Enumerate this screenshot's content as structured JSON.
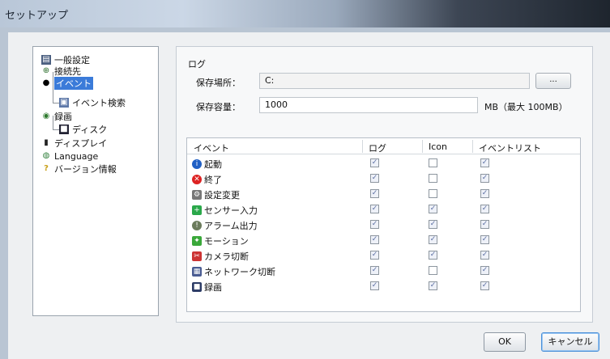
{
  "window": {
    "title": "セットアップ"
  },
  "tree": {
    "items": [
      {
        "label": "一般設定",
        "icon": "general-settings-icon"
      },
      {
        "label": "接続先",
        "icon": "connection-icon"
      },
      {
        "label": "イベント",
        "icon": "event-icon",
        "selected": true
      },
      {
        "label": "イベント検索",
        "icon": "event-search-icon"
      },
      {
        "label": "録画",
        "icon": "recording-icon"
      },
      {
        "label": "ディスク",
        "icon": "disk-icon"
      },
      {
        "label": "ディスプレイ",
        "icon": "display-icon"
      },
      {
        "label": "Language",
        "icon": "language-icon"
      },
      {
        "label": "バージョン情報",
        "icon": "version-info-icon"
      }
    ]
  },
  "log": {
    "group_title": "ログ",
    "save_location_label": "保存場所：",
    "save_location_value": "C:",
    "browse_label": "...",
    "capacity_label": "保存容量：",
    "capacity_value": "1000",
    "capacity_unit": "MB（最大 100MB）"
  },
  "table": {
    "headers": {
      "event": "イベント",
      "log": "ログ",
      "icon": "Icon",
      "event_list": "イベントリスト"
    },
    "rows": [
      {
        "event": "起動",
        "icon": "start-icon",
        "log": true,
        "icon_checked": false,
        "event_list": true
      },
      {
        "event": "終了",
        "icon": "stop-icon",
        "log": true,
        "icon_checked": false,
        "event_list": true
      },
      {
        "event": "設定変更",
        "icon": "settings-change-icon",
        "log": true,
        "icon_checked": false,
        "event_list": true
      },
      {
        "event": "センサー入力",
        "icon": "sensor-input-icon",
        "log": true,
        "icon_checked": true,
        "event_list": true
      },
      {
        "event": "アラーム出力",
        "icon": "alarm-output-icon",
        "log": true,
        "icon_checked": true,
        "event_list": true
      },
      {
        "event": "モーション",
        "icon": "motion-icon",
        "log": true,
        "icon_checked": true,
        "event_list": true
      },
      {
        "event": "カメラ切断",
        "icon": "camera-disconnect-icon",
        "log": true,
        "icon_checked": true,
        "event_list": true
      },
      {
        "event": "ネットワーク切断",
        "icon": "network-disconnect-icon",
        "log": true,
        "icon_checked": false,
        "event_list": true
      },
      {
        "event": "録画",
        "icon": "record-icon",
        "log": true,
        "icon_checked": true,
        "event_list": true
      }
    ]
  },
  "buttons": {
    "ok": "OK",
    "cancel": "キャンセル"
  },
  "check_mark": "✓"
}
